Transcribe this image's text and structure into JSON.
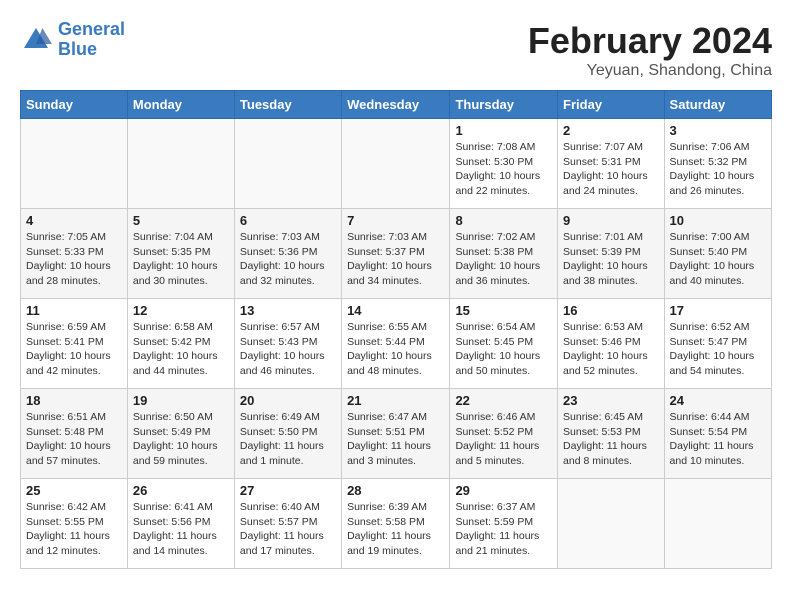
{
  "header": {
    "logo_line1": "General",
    "logo_line2": "Blue",
    "month_year": "February 2024",
    "location": "Yeyuan, Shandong, China"
  },
  "weekdays": [
    "Sunday",
    "Monday",
    "Tuesday",
    "Wednesday",
    "Thursday",
    "Friday",
    "Saturday"
  ],
  "weeks": [
    [
      {
        "day": "",
        "info": ""
      },
      {
        "day": "",
        "info": ""
      },
      {
        "day": "",
        "info": ""
      },
      {
        "day": "",
        "info": ""
      },
      {
        "day": "1",
        "info": "Sunrise: 7:08 AM\nSunset: 5:30 PM\nDaylight: 10 hours\nand 22 minutes."
      },
      {
        "day": "2",
        "info": "Sunrise: 7:07 AM\nSunset: 5:31 PM\nDaylight: 10 hours\nand 24 minutes."
      },
      {
        "day": "3",
        "info": "Sunrise: 7:06 AM\nSunset: 5:32 PM\nDaylight: 10 hours\nand 26 minutes."
      }
    ],
    [
      {
        "day": "4",
        "info": "Sunrise: 7:05 AM\nSunset: 5:33 PM\nDaylight: 10 hours\nand 28 minutes."
      },
      {
        "day": "5",
        "info": "Sunrise: 7:04 AM\nSunset: 5:35 PM\nDaylight: 10 hours\nand 30 minutes."
      },
      {
        "day": "6",
        "info": "Sunrise: 7:03 AM\nSunset: 5:36 PM\nDaylight: 10 hours\nand 32 minutes."
      },
      {
        "day": "7",
        "info": "Sunrise: 7:03 AM\nSunset: 5:37 PM\nDaylight: 10 hours\nand 34 minutes."
      },
      {
        "day": "8",
        "info": "Sunrise: 7:02 AM\nSunset: 5:38 PM\nDaylight: 10 hours\nand 36 minutes."
      },
      {
        "day": "9",
        "info": "Sunrise: 7:01 AM\nSunset: 5:39 PM\nDaylight: 10 hours\nand 38 minutes."
      },
      {
        "day": "10",
        "info": "Sunrise: 7:00 AM\nSunset: 5:40 PM\nDaylight: 10 hours\nand 40 minutes."
      }
    ],
    [
      {
        "day": "11",
        "info": "Sunrise: 6:59 AM\nSunset: 5:41 PM\nDaylight: 10 hours\nand 42 minutes."
      },
      {
        "day": "12",
        "info": "Sunrise: 6:58 AM\nSunset: 5:42 PM\nDaylight: 10 hours\nand 44 minutes."
      },
      {
        "day": "13",
        "info": "Sunrise: 6:57 AM\nSunset: 5:43 PM\nDaylight: 10 hours\nand 46 minutes."
      },
      {
        "day": "14",
        "info": "Sunrise: 6:55 AM\nSunset: 5:44 PM\nDaylight: 10 hours\nand 48 minutes."
      },
      {
        "day": "15",
        "info": "Sunrise: 6:54 AM\nSunset: 5:45 PM\nDaylight: 10 hours\nand 50 minutes."
      },
      {
        "day": "16",
        "info": "Sunrise: 6:53 AM\nSunset: 5:46 PM\nDaylight: 10 hours\nand 52 minutes."
      },
      {
        "day": "17",
        "info": "Sunrise: 6:52 AM\nSunset: 5:47 PM\nDaylight: 10 hours\nand 54 minutes."
      }
    ],
    [
      {
        "day": "18",
        "info": "Sunrise: 6:51 AM\nSunset: 5:48 PM\nDaylight: 10 hours\nand 57 minutes."
      },
      {
        "day": "19",
        "info": "Sunrise: 6:50 AM\nSunset: 5:49 PM\nDaylight: 10 hours\nand 59 minutes."
      },
      {
        "day": "20",
        "info": "Sunrise: 6:49 AM\nSunset: 5:50 PM\nDaylight: 11 hours\nand 1 minute."
      },
      {
        "day": "21",
        "info": "Sunrise: 6:47 AM\nSunset: 5:51 PM\nDaylight: 11 hours\nand 3 minutes."
      },
      {
        "day": "22",
        "info": "Sunrise: 6:46 AM\nSunset: 5:52 PM\nDaylight: 11 hours\nand 5 minutes."
      },
      {
        "day": "23",
        "info": "Sunrise: 6:45 AM\nSunset: 5:53 PM\nDaylight: 11 hours\nand 8 minutes."
      },
      {
        "day": "24",
        "info": "Sunrise: 6:44 AM\nSunset: 5:54 PM\nDaylight: 11 hours\nand 10 minutes."
      }
    ],
    [
      {
        "day": "25",
        "info": "Sunrise: 6:42 AM\nSunset: 5:55 PM\nDaylight: 11 hours\nand 12 minutes."
      },
      {
        "day": "26",
        "info": "Sunrise: 6:41 AM\nSunset: 5:56 PM\nDaylight: 11 hours\nand 14 minutes."
      },
      {
        "day": "27",
        "info": "Sunrise: 6:40 AM\nSunset: 5:57 PM\nDaylight: 11 hours\nand 17 minutes."
      },
      {
        "day": "28",
        "info": "Sunrise: 6:39 AM\nSunset: 5:58 PM\nDaylight: 11 hours\nand 19 minutes."
      },
      {
        "day": "29",
        "info": "Sunrise: 6:37 AM\nSunset: 5:59 PM\nDaylight: 11 hours\nand 21 minutes."
      },
      {
        "day": "",
        "info": ""
      },
      {
        "day": "",
        "info": ""
      }
    ]
  ]
}
